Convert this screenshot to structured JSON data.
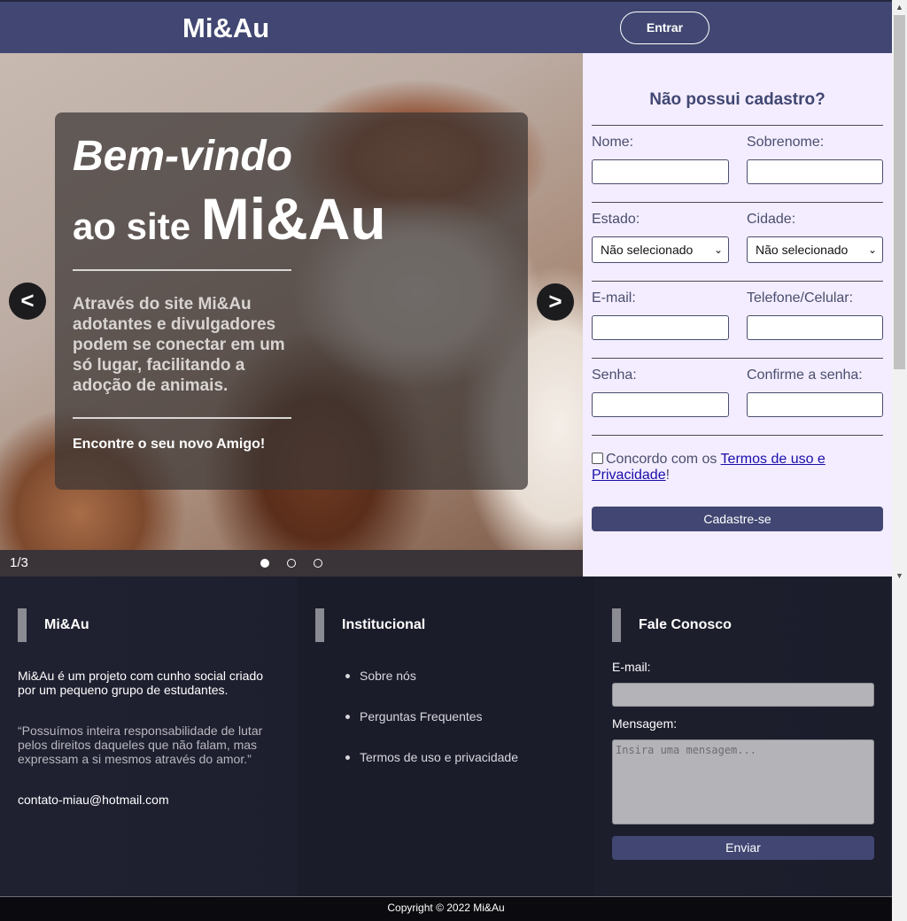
{
  "header": {
    "logo": "Mi&Au",
    "login_label": "Entrar"
  },
  "hero": {
    "title_line1": "Bem-vindo",
    "title_line2_prefix": "ao site",
    "title_line2_brand": "Mi&Au",
    "description": "Através do site Mi&Au adotantes e divulgadores podem se conectar em um só lugar, facilitando a adoção de animais.",
    "cta": "Encontre o seu novo Amigo!",
    "prev_label": "<",
    "next_label": ">",
    "counter": "1/3",
    "slide_index": 1,
    "slide_count": 3
  },
  "signup": {
    "title": "Não possui cadastro?",
    "first_name_label": "Nome:",
    "last_name_label": "Sobrenome:",
    "state_label": "Estado:",
    "state_value": "Não selecionado",
    "city_label": "Cidade:",
    "city_value": "Não selecionado",
    "email_label": "E-mail:",
    "phone_label": "Telefone/Celular:",
    "password_label": "Senha:",
    "confirm_label": "Confirme a senha:",
    "terms_prefix": "Concordo com os",
    "terms_link": "Termos de uso e Privacidade",
    "terms_suffix": "!",
    "submit_label": "Cadastre-se"
  },
  "footer": {
    "about": {
      "heading": "Mi&Au",
      "text": "Mi&Au é um projeto com cunho social criado por um pequeno grupo de estudantes.",
      "quote": "“Possuímos inteira responsabilidade de lutar pelos direitos daqueles que não falam, mas expressam a si mesmos através do amor.”",
      "email": "contato-miau@hotmail.com"
    },
    "institutional": {
      "heading": "Institucional",
      "links": [
        "Sobre nós",
        "Perguntas Frequentes",
        "Termos de uso e privacidade"
      ]
    },
    "contact": {
      "heading": "Fale Conosco",
      "email_label": "E-mail:",
      "message_label": "Mensagem:",
      "message_placeholder": "Insira uma mensagem...",
      "submit_label": "Enviar"
    }
  },
  "copyright": "Copyright © 2022 Mi&Au",
  "colors": {
    "brand": "#414772",
    "signup_bg": "#f3edff",
    "footer_bg": "#1f2030"
  }
}
